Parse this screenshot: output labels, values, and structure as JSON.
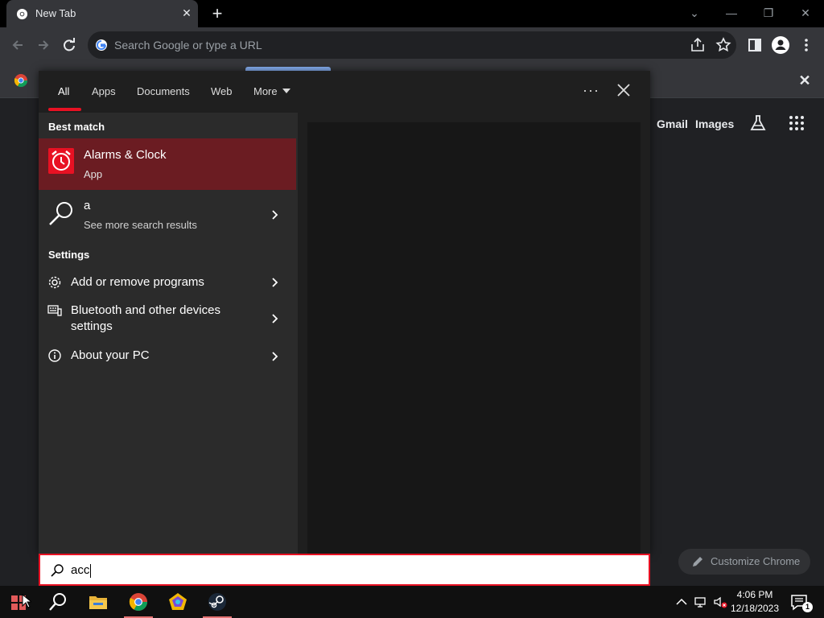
{
  "browser": {
    "tab_title": "New Tab",
    "tab_close": "✕",
    "new_tab": "+",
    "omnibox_placeholder": "Search Google or type a URL",
    "bookmark_close": "✕",
    "window_controls": {
      "tabsearch": "⌄",
      "minimize": "—",
      "restore": "❐",
      "close": "✕"
    }
  },
  "ntp": {
    "gmail": "Gmail",
    "images": "Images",
    "customize_label": "Customize Chrome"
  },
  "search_panel": {
    "tabs": [
      {
        "label": "All",
        "active": true
      },
      {
        "label": "Apps",
        "active": false
      },
      {
        "label": "Documents",
        "active": false
      },
      {
        "label": "Web",
        "active": false
      },
      {
        "label": "More",
        "active": false
      }
    ],
    "more_options": "···",
    "best_match_heading": "Best match",
    "best_match": {
      "title": "Alarms & Clock",
      "subtitle": "App"
    },
    "web_search": {
      "query": "a",
      "subtitle": "See more search results"
    },
    "settings_heading": "Settings",
    "settings_items": [
      {
        "label": "Add or remove programs",
        "icon": "gear-icon"
      },
      {
        "label_line1": "Bluetooth and other devices",
        "label_line2": "settings",
        "icon": "devices-icon"
      },
      {
        "label": "About your PC",
        "icon": "info-icon"
      }
    ],
    "query_text": "acc"
  },
  "taskbar": {
    "time": "4:06 PM",
    "date": "12/18/2023",
    "notification_count": "1"
  },
  "colors": {
    "accent_red": "#e81123",
    "best_match_bg": "#6b1c22",
    "chrome_blue": "#8ab4f8"
  }
}
